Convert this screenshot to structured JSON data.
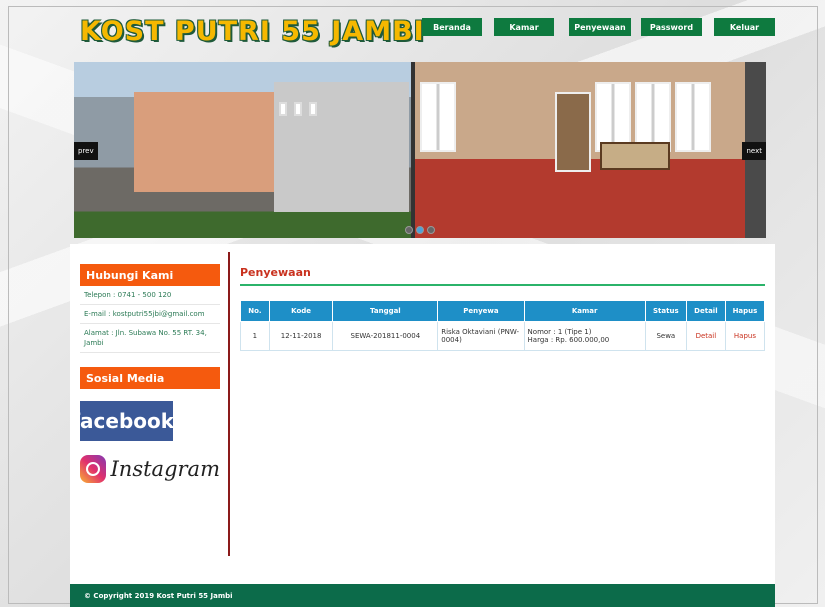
{
  "site": {
    "title": "KOST PUTRI 55 JAMBI"
  },
  "nav": [
    {
      "label": "Beranda"
    },
    {
      "label": "Kamar"
    },
    {
      "label": "Penyewaan"
    },
    {
      "label": "Password"
    },
    {
      "label": "Keluar"
    }
  ],
  "slider": {
    "prev_label": "prev",
    "next_label": "next",
    "dots": 3,
    "active_dot": 1
  },
  "sidebar": {
    "contact_title": "Hubungi Kami",
    "phone": "Telepon : 0741 - 500 120",
    "email": "E-mail : kostputri55jbi@gmail.com",
    "address": "Alamat : Jln. Subawa No. 55 RT. 34, Jambi",
    "social_title": "Sosial Media",
    "facebook_label": "facebook.",
    "instagram_label": "Instagram"
  },
  "main": {
    "title": "Penyewaan",
    "table": {
      "headers": [
        "No.",
        "Kode",
        "Tanggal",
        "Penyewa",
        "Kamar",
        "Status",
        "Detail",
        "Hapus"
      ],
      "rows": [
        {
          "no": "1",
          "kode": "12-11-2018",
          "tanggal": "SEWA-201811-0004",
          "penyewa": "Riska Oktaviani (PNW-0004)",
          "kamar_line1": "Nomor : 1 (Tipe 1)",
          "kamar_line2": "Harga : Rp. 600.000,00",
          "status": "Sewa",
          "detail": "Detail",
          "hapus": "Hapus"
        }
      ]
    }
  },
  "footer": {
    "text": "© Copyright 2019 Kost Putri 55 Jambi"
  },
  "colors": {
    "nav_bg": "#0e7a3f",
    "side_head": "#f55a0e",
    "table_head": "#1e8fc7",
    "footer": "#0c6b4a",
    "title": "#c9311e"
  }
}
